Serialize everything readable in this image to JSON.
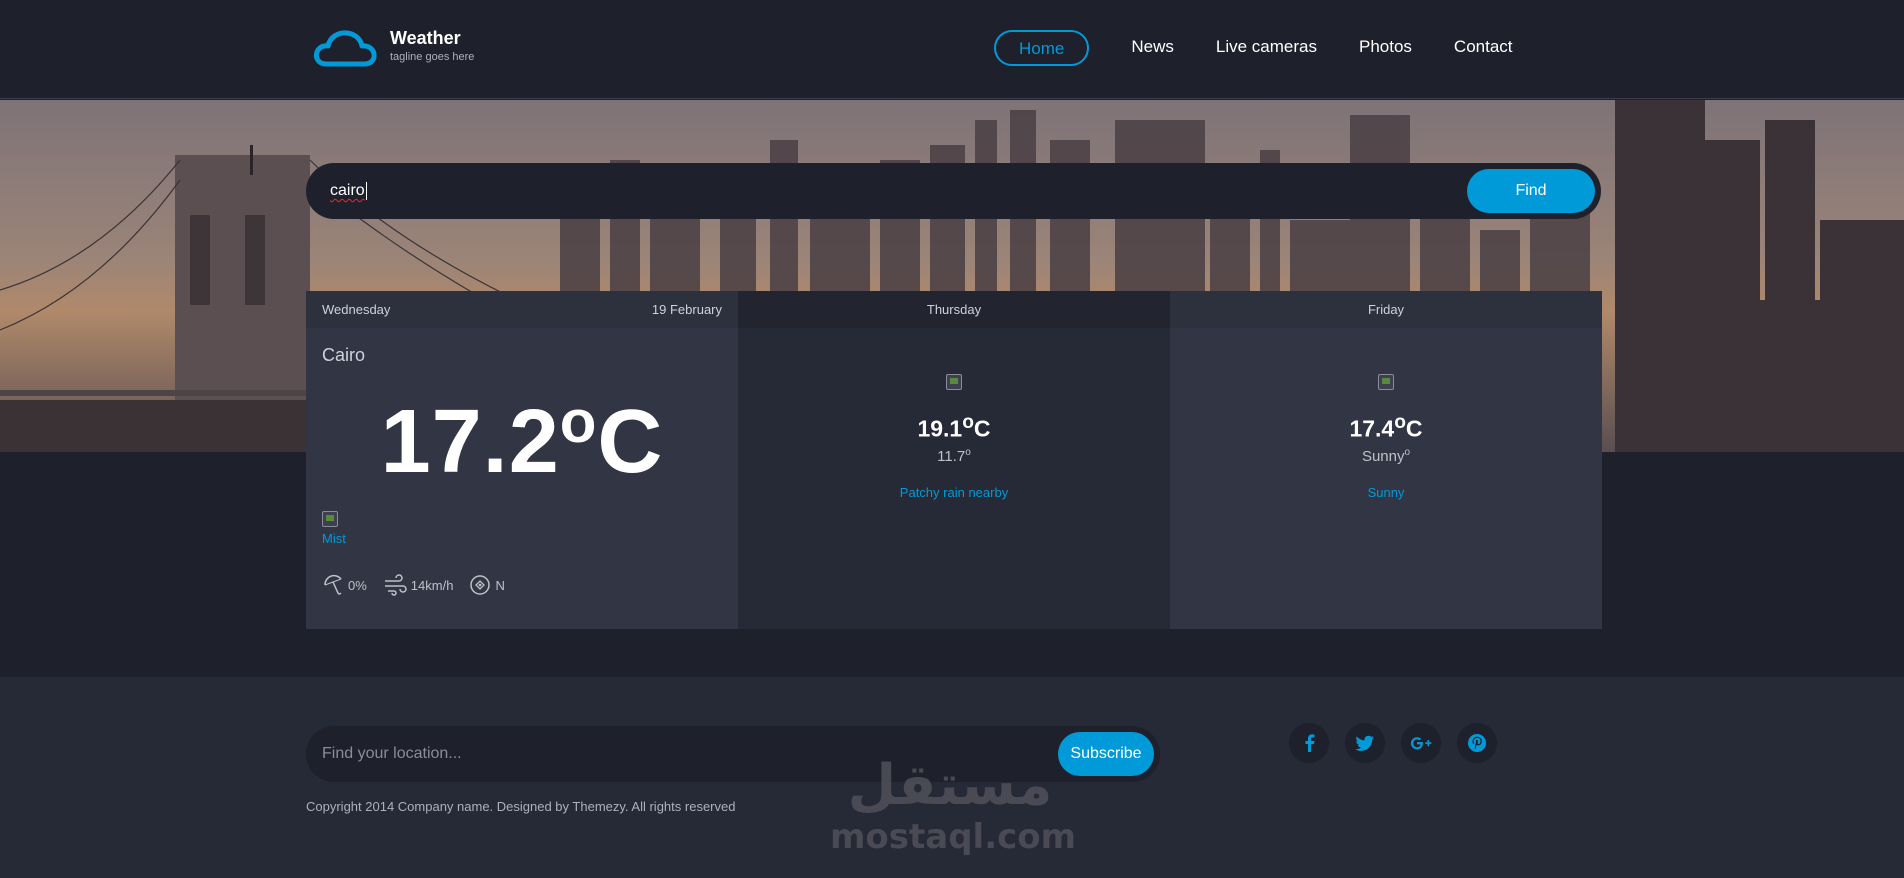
{
  "brand": {
    "title": "Weather",
    "tagline": "tagline goes here",
    "accent": "#009ad8"
  },
  "nav": {
    "items": [
      "Home",
      "News",
      "Live cameras",
      "Photos",
      "Contact"
    ],
    "active": "Home"
  },
  "search": {
    "value": "cairo",
    "button": "Find"
  },
  "today": {
    "day": "Wednesday",
    "date": "19 February",
    "city": "Cairo",
    "temp": "17.2",
    "deg": "o",
    "unit": "C",
    "condition": "Mist",
    "humidity": "0%",
    "wind": "14km/h",
    "direction": "N"
  },
  "forecast": [
    {
      "day": "Thursday",
      "high": "19.1",
      "low": "11.7",
      "low_suffix": "",
      "condition": "Patchy rain nearby"
    },
    {
      "day": "Friday",
      "high": "17.4",
      "low": "Sunny",
      "low_suffix": "",
      "condition": "Sunny"
    }
  ],
  "footer": {
    "placeholder": "Find your location...",
    "subscribe": "Subscribe",
    "copyright": "Copyright 2014 Company name. Designed by Themezy. All rights reserved",
    "social": [
      "facebook-icon",
      "twitter-icon",
      "google-plus-icon",
      "pinterest-icon"
    ]
  },
  "watermark": {
    "arabic": "مستقل",
    "latin": "mostaql.com"
  }
}
